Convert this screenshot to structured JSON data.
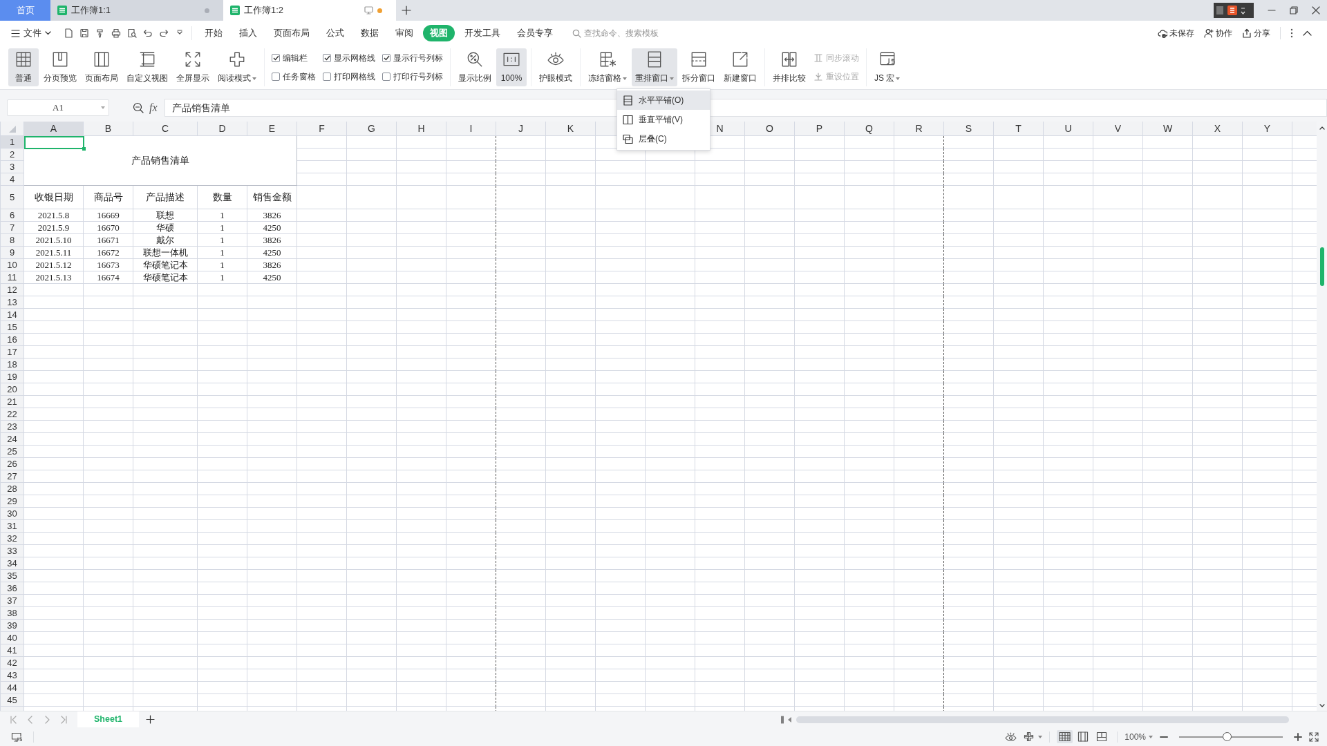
{
  "tabs": [
    {
      "kind": "home",
      "label": "首页",
      "selected": false
    },
    {
      "kind": "document",
      "label": "工作簿1:1",
      "selected": false,
      "modified": false
    },
    {
      "kind": "document",
      "label": "工作簿1:2",
      "selected": true,
      "modified": true
    }
  ],
  "menu_bar": {
    "file_menu": "文件",
    "tabs": [
      {
        "label": "开始",
        "selected": false
      },
      {
        "label": "插入",
        "selected": false
      },
      {
        "label": "页面布局",
        "selected": false
      },
      {
        "label": "公式",
        "selected": false
      },
      {
        "label": "数据",
        "selected": false
      },
      {
        "label": "审阅",
        "selected": false
      },
      {
        "label": "视图",
        "selected": true
      },
      {
        "label": "开发工具",
        "selected": false
      },
      {
        "label": "会员专享",
        "selected": false
      }
    ],
    "search": {
      "placeholder": "查找命令、搜索模板"
    },
    "actions": [
      {
        "label": "未保存"
      },
      {
        "label": "协作"
      },
      {
        "label": "分享"
      }
    ]
  },
  "ribbon": {
    "groups": [
      {
        "items": [
          {
            "kind": "large",
            "label": "普通",
            "selected": true,
            "dropdown": false
          },
          {
            "kind": "large",
            "label": "分页预览",
            "selected": false,
            "dropdown": false
          },
          {
            "kind": "large",
            "label": "页面布局",
            "selected": false,
            "dropdown": false
          },
          {
            "kind": "large",
            "label": "自定义视图",
            "selected": false,
            "dropdown": false
          },
          {
            "kind": "large",
            "label": "全屏显示",
            "selected": false,
            "dropdown": false
          },
          {
            "kind": "large",
            "label": "阅读模式",
            "selected": false,
            "dropdown": true
          }
        ]
      },
      {
        "items": [
          {
            "kind": "check",
            "label": "编辑栏",
            "checked": true
          },
          {
            "kind": "check",
            "label": "任务窗格",
            "checked": false
          },
          {
            "kind": "check",
            "label": "显示网格线",
            "checked": true
          },
          {
            "kind": "check",
            "label": "打印网格线",
            "checked": false
          },
          {
            "kind": "check",
            "label": "显示行号列标",
            "checked": true
          },
          {
            "kind": "check",
            "label": "打印行号列标",
            "checked": false
          }
        ]
      },
      {
        "items": [
          {
            "kind": "large",
            "label": "显示比例",
            "selected": false,
            "dropdown": false
          },
          {
            "kind": "large",
            "label": "100%",
            "selected": true,
            "dropdown": false
          }
        ]
      },
      {
        "items": [
          {
            "kind": "large",
            "label": "护眼模式",
            "selected": false,
            "dropdown": false
          }
        ]
      },
      {
        "items": [
          {
            "kind": "large",
            "label": "冻结窗格",
            "selected": false,
            "dropdown": true
          },
          {
            "kind": "large",
            "label": "重排窗口",
            "selected": true,
            "dropdown": true,
            "menu": [
              {
                "label": "水平平铺(O)",
                "selected": true
              },
              {
                "label": "垂直平铺(V)",
                "selected": false
              },
              {
                "label": "层叠(C)",
                "selected": false
              }
            ]
          },
          {
            "kind": "large",
            "label": "拆分窗口",
            "selected": false,
            "dropdown": false
          },
          {
            "kind": "large",
            "label": "新建窗口",
            "selected": false,
            "dropdown": false
          }
        ]
      },
      {
        "items": [
          {
            "kind": "large",
            "label": "并排比较",
            "selected": false,
            "dropdown": false
          },
          {
            "kind": "small",
            "label": "同步滚动",
            "disabled": true
          },
          {
            "kind": "small",
            "label": "重设位置",
            "disabled": true
          }
        ]
      },
      {
        "items": [
          {
            "kind": "large",
            "label": "JS 宏",
            "selected": false,
            "dropdown": true
          }
        ]
      }
    ]
  },
  "formula_bar": {
    "name_box": "A1",
    "function_label": "fx",
    "formula": "产品销售清单"
  },
  "sheet": {
    "columns": [
      {
        "label": "A",
        "selected": true,
        "page_break": false
      },
      {
        "label": "B",
        "selected": false,
        "page_break": false
      },
      {
        "label": "C",
        "selected": false,
        "page_break": false
      },
      {
        "label": "D",
        "selected": false,
        "page_break": false
      },
      {
        "label": "E",
        "selected": false,
        "page_break": false
      },
      {
        "label": "F",
        "selected": false,
        "page_break": false
      },
      {
        "label": "G",
        "selected": false,
        "page_break": false
      },
      {
        "label": "H",
        "selected": false,
        "page_break": false
      },
      {
        "label": "I",
        "selected": false,
        "page_break": true
      },
      {
        "label": "J",
        "selected": false,
        "page_break": false
      },
      {
        "label": "K",
        "selected": false,
        "page_break": false
      },
      {
        "page_break": false
      },
      {
        "page_break": false
      },
      {
        "label": "N",
        "selected": false,
        "page_break": false
      },
      {
        "label": "O",
        "selected": false,
        "page_break": false
      },
      {
        "label": "P",
        "selected": false,
        "page_break": false
      },
      {
        "label": "Q",
        "selected": false,
        "page_break": false
      },
      {
        "label": "R",
        "selected": false,
        "page_break": true
      },
      {
        "label": "S",
        "selected": false,
        "page_break": false
      },
      {
        "label": "T",
        "selected": false,
        "page_break": false
      },
      {
        "label": "U",
        "selected": false,
        "page_break": false
      },
      {
        "label": "V",
        "selected": false,
        "page_break": false
      },
      {
        "label": "W",
        "selected": false,
        "page_break": false
      },
      {
        "label": "X",
        "selected": false,
        "page_break": false
      },
      {
        "label": "Y",
        "selected": false,
        "page_break": false
      }
    ],
    "row_numbers": [
      {
        "label": "1",
        "selected": true
      },
      {
        "label": "2",
        "selected": false
      },
      {
        "label": "3",
        "selected": false
      },
      {
        "label": "4",
        "selected": false
      },
      {
        "label": "5",
        "selected": false
      },
      {
        "label": "6",
        "selected": false
      },
      {
        "label": "7",
        "selected": false
      },
      {
        "label": "8",
        "selected": false
      },
      {
        "label": "9",
        "selected": false
      },
      {
        "label": "10",
        "selected": false
      },
      {
        "label": "11",
        "selected": false
      },
      {
        "label": "12",
        "selected": false
      },
      {
        "label": "13",
        "selected": false
      },
      {
        "label": "14",
        "selected": false
      },
      {
        "label": "15",
        "selected": false
      },
      {
        "label": "16",
        "selected": false
      },
      {
        "label": "17",
        "selected": false
      },
      {
        "label": "18",
        "selected": false
      },
      {
        "label": "19",
        "selected": false
      },
      {
        "label": "20",
        "selected": false
      },
      {
        "label": "21",
        "selected": false
      },
      {
        "label": "22",
        "selected": false
      },
      {
        "label": "23",
        "selected": false
      },
      {
        "label": "24",
        "selected": false
      },
      {
        "label": "25",
        "selected": false
      },
      {
        "label": "26",
        "selected": false
      },
      {
        "label": "27",
        "selected": false
      },
      {
        "label": "28",
        "selected": false
      },
      {
        "label": "29",
        "selected": false
      },
      {
        "label": "30",
        "selected": false
      },
      {
        "label": "31",
        "selected": false
      },
      {
        "label": "32",
        "selected": false
      },
      {
        "label": "33",
        "selected": false
      },
      {
        "label": "34",
        "selected": false
      },
      {
        "label": "35",
        "selected": false
      },
      {
        "label": "36",
        "selected": false
      },
      {
        "label": "37",
        "selected": false
      },
      {
        "label": "38",
        "selected": false
      },
      {
        "label": "39",
        "selected": false
      },
      {
        "label": "40",
        "selected": false
      },
      {
        "label": "41",
        "selected": false
      },
      {
        "label": "42",
        "selected": false
      },
      {
        "label": "43",
        "selected": false
      },
      {
        "label": "44",
        "selected": false
      },
      {
        "label": "45",
        "selected": false
      }
    ],
    "title": "产品销售清单",
    "header": [
      "收银日期",
      "商品号",
      "产品描述",
      "数量",
      "销售金额"
    ],
    "rows": [
      [
        "2021.5.8",
        "16669",
        "联想",
        "1",
        "3826"
      ],
      [
        "2021.5.9",
        "16670",
        "华硕",
        "1",
        "4250"
      ],
      [
        "2021.5.10",
        "16671",
        "戴尔",
        "1",
        "3826"
      ],
      [
        "2021.5.11",
        "16672",
        "联想一体机",
        "1",
        "4250"
      ],
      [
        "2021.5.12",
        "16673",
        "华硕笔记本",
        "1",
        "3826"
      ],
      [
        "2021.5.13",
        "16674",
        "华硕笔记本",
        "1",
        "4250"
      ]
    ]
  },
  "sheet_tabs": [
    {
      "label": "Sheet1",
      "selected": true
    }
  ],
  "status_bar": {
    "views": [
      {
        "selected": true
      },
      {
        "selected": false
      },
      {
        "selected": false
      }
    ],
    "zoom": "100%",
    "zoom_slider": {
      "level": 0.46
    }
  }
}
